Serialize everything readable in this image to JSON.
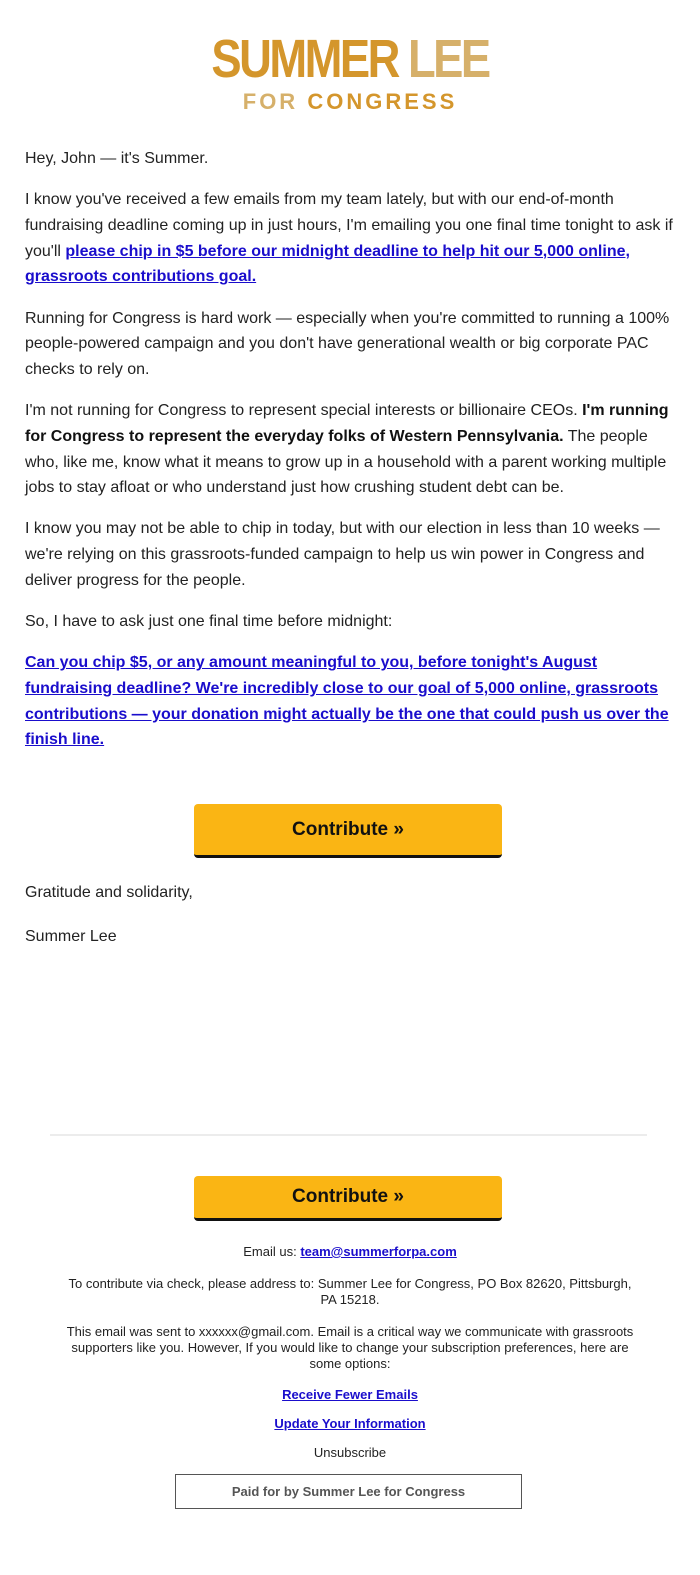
{
  "header": {
    "logo": {
      "line1_word1": "SUMMER",
      "line1_word2": "LEE",
      "line2_word1": "FOR",
      "line2_word2": "CONGRESS",
      "colors": {
        "dark_gold": "#d4962c",
        "light_gold": "#d6b06a"
      }
    }
  },
  "body": {
    "greeting": "Hey, John — it's Summer.",
    "p1_text": "I know you've received a few emails from my team lately, but with our end-of-month fundraising deadline coming up in just hours, I'm emailing you one final time tonight to ask if you'll ",
    "p1_link": "please chip in $5 before our midnight deadline to help hit our 5,000 online, grassroots contributions goal.",
    "p2": "Running for Congress is hard work — especially when you're committed to running a 100% people-powered campaign and you don't have generational wealth or big corporate PAC checks to rely on.",
    "p3_text_before": "I'm not running for Congress to represent special interests or billionaire CEOs. ",
    "p3_bold": "I'm running for Congress to represent the everyday folks of Western Pennsylvania.",
    "p3_text_after": " The people who, like me, know what it means to grow up in a household with a parent working multiple jobs to stay afloat or who understand just how crushing student debt can be.",
    "p4": "I know you may not be able to chip in today, but with our election in less than 10 weeks — we're relying on this grassroots-funded campaign to help us win power in Congress and deliver progress for the people.",
    "p5": "So, I have to ask just one final time before midnight:",
    "p6_link": "Can you chip $5, or any amount meaningful to you, before tonight's August fundraising deadline? We're incredibly close to our goal of 5,000 online, grassroots contributions — your donation might actually be the one that could push us over the finish line.",
    "contribute_button": "Contribute »",
    "signoff": "Gratitude and solidarity,",
    "signature": "Summer Lee"
  },
  "footer": {
    "contribute_button": "Contribute »",
    "email_label": "Email us: ",
    "email_link": "team@summerforpa.com",
    "check_address": "To contribute via check, please address to: Summer Lee for Congress, PO Box 82620, Pittsburgh, PA 15218.",
    "sent_notice": "This email was sent to xxxxxx@gmail.com. Email is a critical way we communicate with grassroots supporters like you. However, If you would like to change your subscription preferences, here are some options:",
    "links": [
      "Receive Fewer Emails",
      "Update Your Information"
    ],
    "unsubscribe": "Unsubscribe",
    "paid_for": "Paid for by Summer Lee for Congress"
  },
  "colors": {
    "button": "#fab514",
    "link": "#1a0dcc",
    "text": "#222222"
  }
}
